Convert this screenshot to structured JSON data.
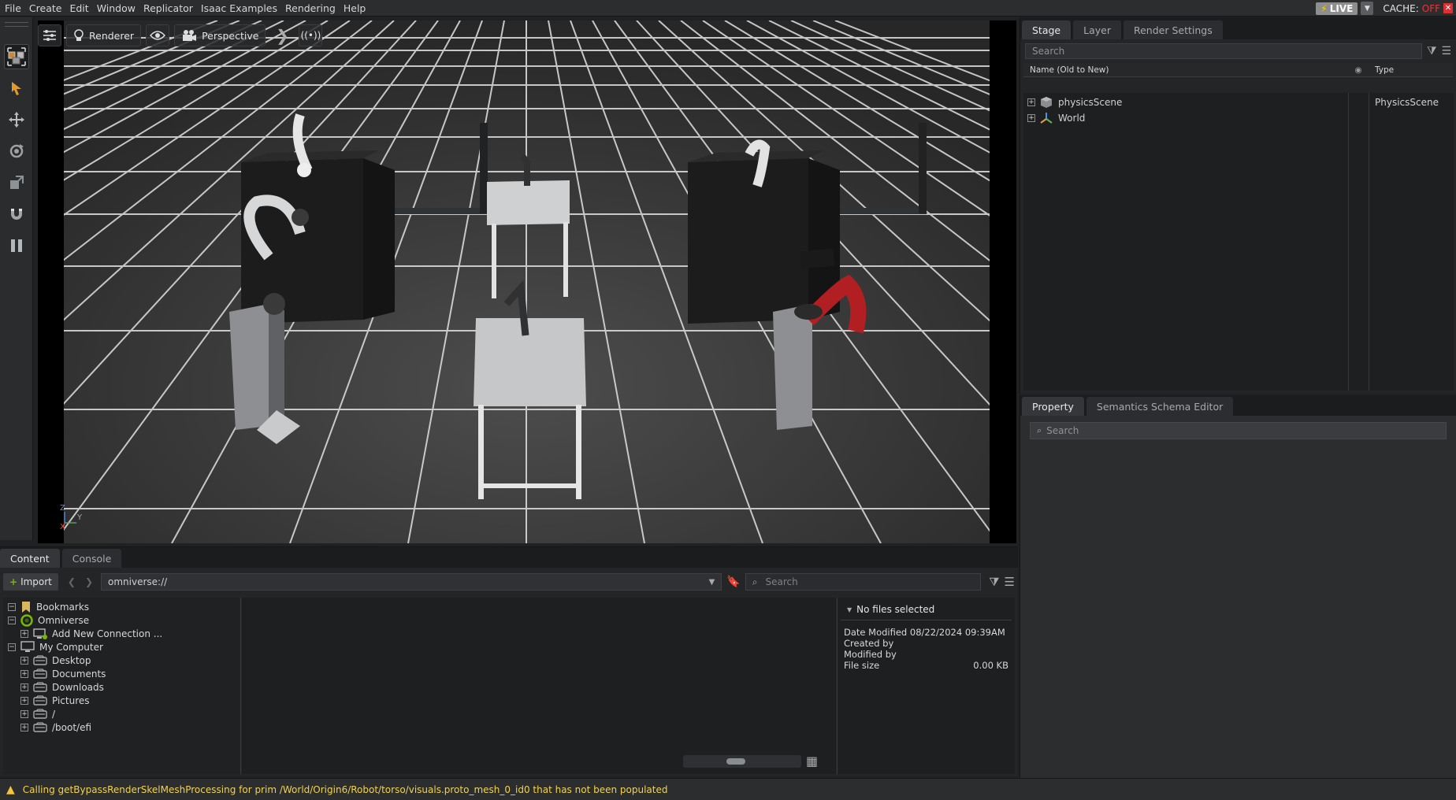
{
  "menu": [
    "File",
    "Create",
    "Edit",
    "Window",
    "Replicator",
    "Isaac Examples",
    "Rendering",
    "Help"
  ],
  "live": {
    "label": "LIVE",
    "cache_label": "CACHE:",
    "cache_state": "OFF"
  },
  "viewport": {
    "renderer_label": "Renderer",
    "camera_label": "Perspective",
    "axis": {
      "z": "Z",
      "y": "Y",
      "x": "X"
    }
  },
  "stage": {
    "tabs": [
      "Stage",
      "Layer",
      "Render Settings"
    ],
    "search_placeholder": "Search",
    "col_name": "Name (Old to New)",
    "col_type": "Type",
    "rows": [
      {
        "name": "physicsScene",
        "type": "PhysicsScene",
        "icon": "physics-cube-icon"
      },
      {
        "name": "World",
        "type": "",
        "icon": "xform-axis-icon"
      }
    ]
  },
  "property": {
    "tabs": [
      "Property",
      "Semantics Schema Editor"
    ],
    "search_placeholder": "Search"
  },
  "content": {
    "tabs": [
      "Content",
      "Console"
    ],
    "import_label": "Import",
    "path": "omniverse://",
    "search_placeholder": "Search",
    "tree": [
      {
        "label": "Bookmarks",
        "level": 0,
        "expander": "−",
        "icon": "bookmark-icon"
      },
      {
        "label": "Omniverse",
        "level": 0,
        "expander": "−",
        "icon": "omniverse-icon"
      },
      {
        "label": "Add New Connection ...",
        "level": 1,
        "expander": "+",
        "icon": "connection-icon"
      },
      {
        "label": "My Computer",
        "level": 0,
        "expander": "−",
        "icon": "computer-icon"
      },
      {
        "label": "Desktop",
        "level": 1,
        "expander": "+",
        "icon": "drive-icon"
      },
      {
        "label": "Documents",
        "level": 1,
        "expander": "+",
        "icon": "drive-icon"
      },
      {
        "label": "Downloads",
        "level": 1,
        "expander": "+",
        "icon": "drive-icon"
      },
      {
        "label": "Pictures",
        "level": 1,
        "expander": "+",
        "icon": "drive-icon"
      },
      {
        "label": "/",
        "level": 1,
        "expander": "+",
        "icon": "drive-icon"
      },
      {
        "label": "/boot/efi",
        "level": 1,
        "expander": "+",
        "icon": "drive-icon"
      }
    ],
    "info": {
      "title": "No files selected",
      "date_modified_label": "Date Modified",
      "date_modified_value": "08/22/2024 09:39AM",
      "created_by_label": "Created by",
      "modified_by_label": "Modified by",
      "file_size_label": "File size",
      "file_size_value": "0.00 KB"
    }
  },
  "status": {
    "message": "Calling getBypassRenderSkelMeshProcessing for prim /World/Origin6/Robot/torso/visuals.proto_mesh_0_id0 that has not been populated"
  },
  "colors": {
    "accent_live": "#8e8e8e",
    "cache_off": "#e23b3b",
    "warning": "#f2d34e",
    "omniverse_green": "#76b900"
  }
}
